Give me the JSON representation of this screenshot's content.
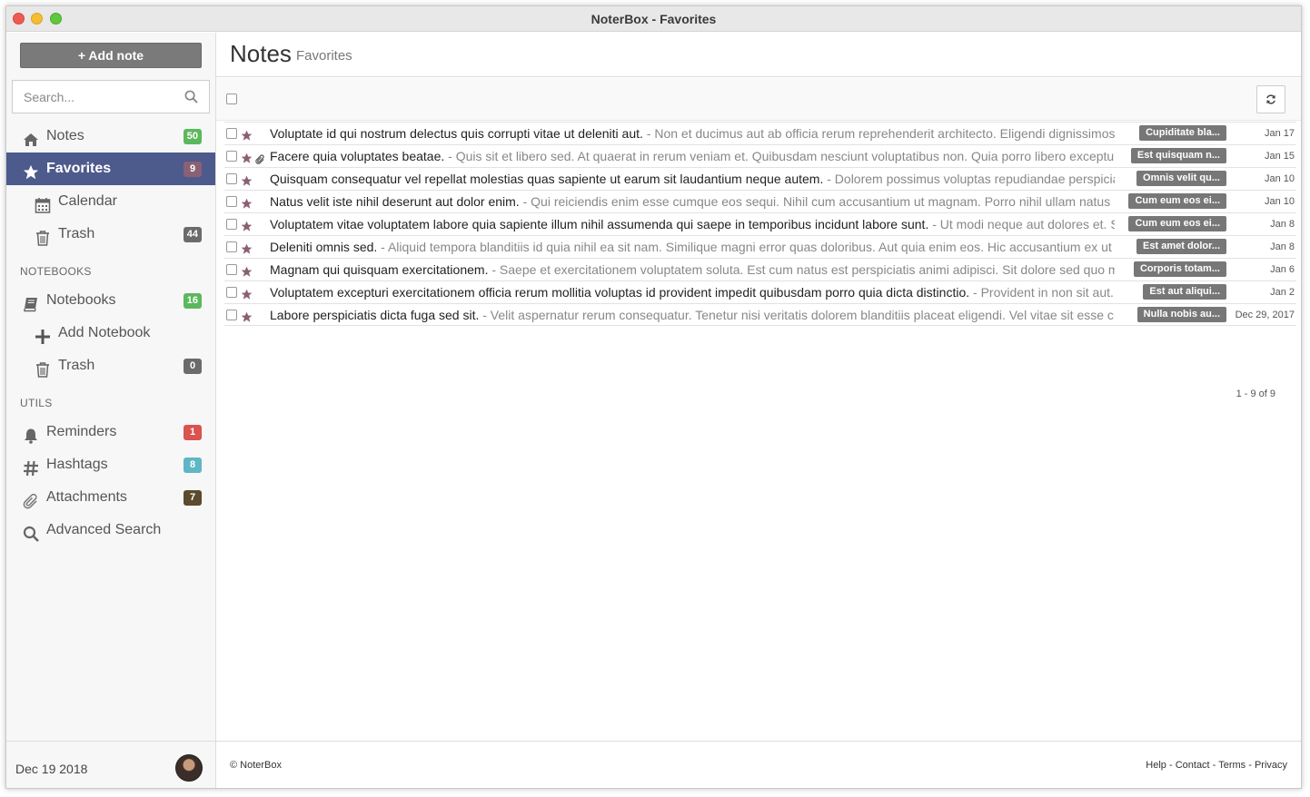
{
  "window": {
    "title": "NoterBox - Favorites"
  },
  "sidebar": {
    "add_note_label": "+ Add note",
    "search_placeholder": "Search...",
    "items": [
      {
        "label": "Notes",
        "badge": "50",
        "badge_color": "#5cb85c",
        "icon": "home-icon"
      },
      {
        "label": "Favorites",
        "badge": "9",
        "badge_color": "#8a6074",
        "icon": "star-icon",
        "active": true
      },
      {
        "label": "Calendar",
        "icon": "calendar-icon"
      },
      {
        "label": "Trash",
        "badge": "44",
        "badge_color": "#6b6b6b",
        "icon": "trash-icon"
      }
    ],
    "notebooks_heading": "NOTEBOOKS",
    "notebooks": [
      {
        "label": "Notebooks",
        "badge": "16",
        "badge_color": "#5cb85c",
        "icon": "book-icon"
      },
      {
        "label": "Add Notebook",
        "icon": "plus-icon"
      },
      {
        "label": "Trash",
        "badge": "0",
        "badge_color": "#6b6b6b",
        "icon": "trash-icon"
      }
    ],
    "utils_heading": "UTILS",
    "utils": [
      {
        "label": "Reminders",
        "badge": "1",
        "badge_color": "#d9534f",
        "icon": "bell-icon"
      },
      {
        "label": "Hashtags",
        "badge": "8",
        "badge_color": "#5bc0de",
        "icon": "hashtag-icon"
      },
      {
        "label": "Attachments",
        "badge": "7",
        "badge_color": "#5c4a2e",
        "icon": "paperclip-icon"
      },
      {
        "label": "Advanced Search",
        "icon": "search-icon"
      }
    ],
    "footer_date": "Dec 19 2018"
  },
  "main": {
    "title": "Notes",
    "subtitle": "Favorites",
    "pager": "1 - 9 of 9",
    "accent_color": "#8a6074",
    "notes": [
      {
        "title": "Voluptate id qui nostrum delectus quis corrupti vitae ut deleniti aut.",
        "snippet": " - Non et ducimus aut ab officia rerum reprehenderit architecto. Eligendi dignissimos",
        "tag": "Cupiditate bla...",
        "date": "Jan 17",
        "attachment": false
      },
      {
        "title": "Facere quia voluptates beatae.",
        "snippet": " - Quis sit et libero sed. At quaerat in rerum veniam et. Quibusdam nesciunt voluptatibus non. Quia porro libero exceptu",
        "tag": "Est quisquam n...",
        "date": "Jan 15",
        "attachment": true
      },
      {
        "title": "Quisquam consequatur vel repellat molestias quas sapiente ut earum sit laudantium neque autem.",
        "snippet": " - Dolorem possimus voluptas repudiandae perspicia",
        "tag": "Omnis velit qu...",
        "date": "Jan 10",
        "attachment": false
      },
      {
        "title": "Natus velit iste nihil deserunt aut dolor enim.",
        "snippet": " - Qui reiciendis enim esse cumque eos sequi. Nihil cum accusantium ut magnam. Porro nihil ullam natus",
        "tag": "Cum eum eos ei...",
        "date": "Jan 10",
        "attachment": false
      },
      {
        "title": "Voluptatem vitae voluptatem labore quia sapiente illum nihil assumenda qui saepe in temporibus incidunt labore sunt.",
        "snippet": " - Ut modi neque aut dolores et. S",
        "tag": "Cum eum eos ei...",
        "date": "Jan 8",
        "attachment": false
      },
      {
        "title": "Deleniti omnis sed.",
        "snippet": " - Aliquid tempora blanditiis id quia nihil ea sit nam. Similique magni error quas doloribus. Aut quia enim eos. Hic accusantium ex ut",
        "tag": "Est amet dolor...",
        "date": "Jan 8",
        "attachment": false
      },
      {
        "title": "Magnam qui quisquam exercitationem.",
        "snippet": " - Saepe et exercitationem voluptatem soluta. Est cum natus est perspiciatis animi adipisci. Sit dolore sed quo m",
        "tag": "Corporis totam...",
        "date": "Jan 6",
        "attachment": false
      },
      {
        "title": "Voluptatem excepturi exercitationem officia rerum mollitia voluptas id provident impedit quibusdam porro quia dicta distinctio.",
        "snippet": " - Provident in non sit aut.",
        "tag": "Est aut aliqui...",
        "date": "Jan 2",
        "attachment": false
      },
      {
        "title": "Labore perspiciatis dicta fuga sed sit.",
        "snippet": " - Velit aspernatur rerum consequatur. Tenetur nisi veritatis dolorem blanditiis placeat eligendi. Vel vitae sit esse c",
        "tag": "Nulla nobis au...",
        "date": "Dec 29, 2017",
        "attachment": false
      }
    ],
    "footer": {
      "copyright": "© NoterBox",
      "links": [
        "Help",
        "Contact",
        "Terms",
        "Privacy"
      ],
      "separator": " - "
    }
  }
}
